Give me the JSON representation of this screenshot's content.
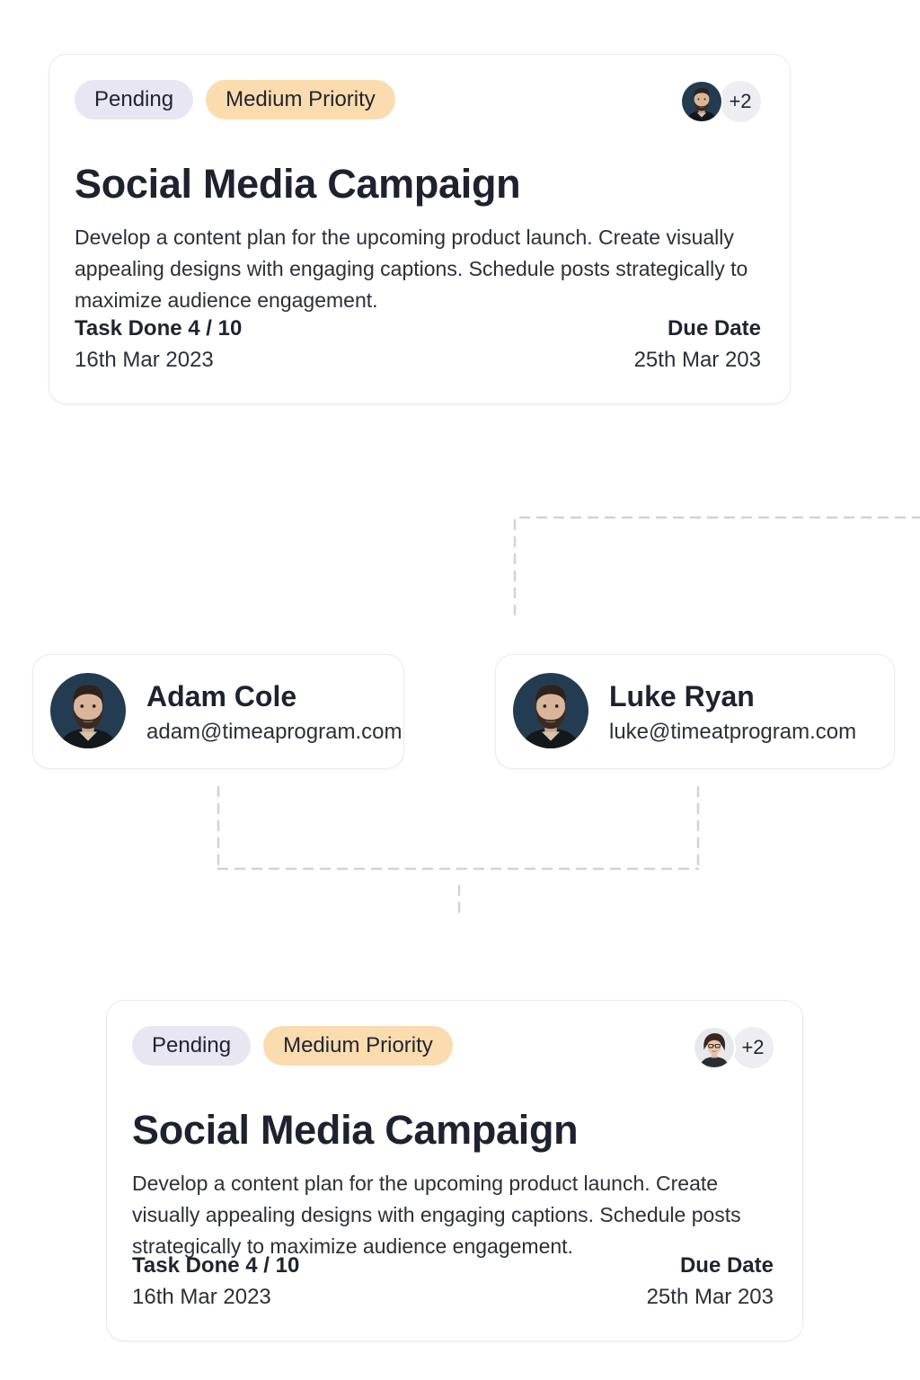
{
  "colors": {
    "pending_badge_bg": "#e7e6f2",
    "priority_badge_bg": "#fbdcaf",
    "text_dark": "#1e2230",
    "card_border": "#ececf0"
  },
  "cards": [
    {
      "status": "Pending",
      "priority": "Medium Priority",
      "member_avatar_icon": "bearded-man-avatar",
      "extra_members": "+2",
      "title": "Social Media Campaign",
      "description": "Develop a content plan for the upcoming product launch. Create visually appealing designs with engaging captions. Schedule posts strategically to maximize audience engagement.",
      "task_label": "Task Done 4 / 10",
      "start_date": "16th Mar 2023",
      "due_label": "Due Date",
      "due_date": "25th Mar 203"
    },
    {
      "status": "Pending",
      "priority": "Medium Priority",
      "member_avatar_icon": "woman-with-glasses-avatar",
      "extra_members": "+2",
      "title": "Social Media Campaign",
      "description": "Develop a content plan for the upcoming product launch. Create visually appealing designs with engaging captions. Schedule posts strategically to maximize audience engagement.",
      "task_label": "Task Done 4 / 10",
      "start_date": "16th Mar 2023",
      "due_label": "Due Date",
      "due_date": "25th Mar 203"
    }
  ],
  "people": [
    {
      "name": "Adam Cole",
      "email": "adam@timeaprogram.com",
      "avatar_icon": "bearded-man-avatar"
    },
    {
      "name": "Luke Ryan",
      "email": "luke@timeatprogram.com",
      "avatar_icon": "bearded-man-avatar"
    }
  ]
}
